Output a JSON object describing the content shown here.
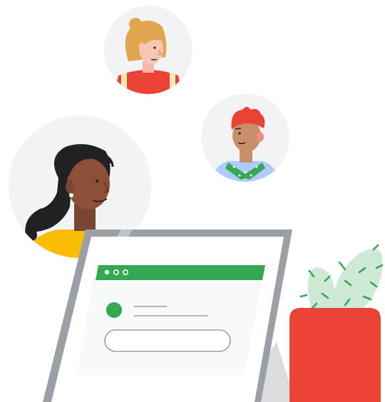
{
  "illustration": {
    "people": [
      {
        "name": "person-blonde-avatar",
        "shirt_color": "#ea4335"
      },
      {
        "name": "person-red-hair-avatar",
        "shirt_color": "#aecbfa",
        "scarf_color": "#34a853"
      },
      {
        "name": "person-dark-hair-avatar",
        "shirt_color": "#fbbc04"
      }
    ],
    "tablet": {
      "window_dots": [
        "dot",
        "dot",
        "dot"
      ],
      "header_color": "#34a853",
      "status_dot_color": "#34a853"
    },
    "plant": {
      "pot_color": "#ea4335",
      "leaf_color": "#ceead6",
      "spike_color": "#34a853"
    },
    "colors": {
      "bubble_bg": "#f1f3f4",
      "frame": "#9aa0a6",
      "screen_bg": "#f8f9fa"
    }
  }
}
